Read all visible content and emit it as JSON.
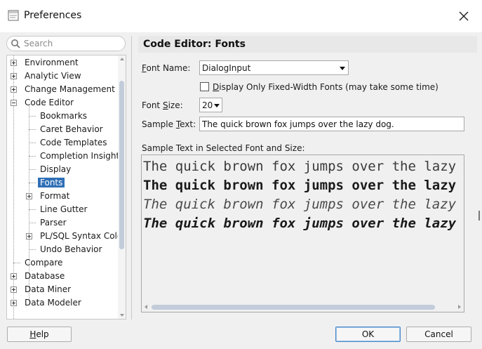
{
  "window": {
    "title": "Preferences"
  },
  "search": {
    "placeholder": "Search"
  },
  "tree": [
    {
      "label": "Environment",
      "expander": "plus"
    },
    {
      "label": "Analytic View",
      "expander": "plus"
    },
    {
      "label": "Change Management F",
      "expander": "plus"
    },
    {
      "label": "Code Editor",
      "expander": "minus"
    },
    {
      "label": "Bookmarks"
    },
    {
      "label": "Caret Behavior"
    },
    {
      "label": "Code Templates"
    },
    {
      "label": "Completion Insight"
    },
    {
      "label": "Display"
    },
    {
      "label": "Fonts",
      "selected": true
    },
    {
      "label": "Format",
      "expander": "plus"
    },
    {
      "label": "Line Gutter"
    },
    {
      "label": "Parser"
    },
    {
      "label": "PL/SQL Syntax Colc",
      "expander": "plus"
    },
    {
      "label": "Undo Behavior"
    },
    {
      "label": "Compare"
    },
    {
      "label": "Database",
      "expander": "plus"
    },
    {
      "label": "Data Miner",
      "expander": "plus"
    },
    {
      "label": "Data Modeler",
      "expander": "plus"
    }
  ],
  "panel": {
    "title": "Code Editor: Fonts",
    "font_name": {
      "label_mnemonic": "F",
      "label_rest": "ont Name:",
      "value": "DialogInput"
    },
    "fixed_width": {
      "label_mnemonic": "D",
      "label_rest": "isplay Only Fixed-Width Fonts (may take some time)",
      "checked": false
    },
    "font_size": {
      "label_start": "Font ",
      "label_mnemonic": "S",
      "label_rest": "ize:",
      "value": "20"
    },
    "sample_text": {
      "label_start": "Sample ",
      "label_mnemonic": "T",
      "label_rest": "ext:",
      "value": "The quick brown fox jumps over the lazy dog."
    },
    "preview": {
      "label": "Sample Text in Selected Font and Size:",
      "lines": [
        "The quick brown fox jumps over the lazy dog.",
        "The quick brown fox jumps over the lazy dog.",
        "The quick brown fox jumps over the lazy dog.",
        "The quick brown fox jumps over the lazy dog."
      ]
    }
  },
  "buttons": {
    "help": {
      "mnemonic": "H",
      "rest": "elp"
    },
    "ok": "OK",
    "cancel": "Cancel"
  },
  "colors": {
    "selection": "#2f6fb6",
    "header_bg": "#e8e8e8",
    "scroll_thumb": "#c2ccda"
  },
  "icons": [
    "preferences-app-icon",
    "close-icon",
    "search-icon",
    "chevron-down-icon",
    "checkbox-icon"
  ]
}
